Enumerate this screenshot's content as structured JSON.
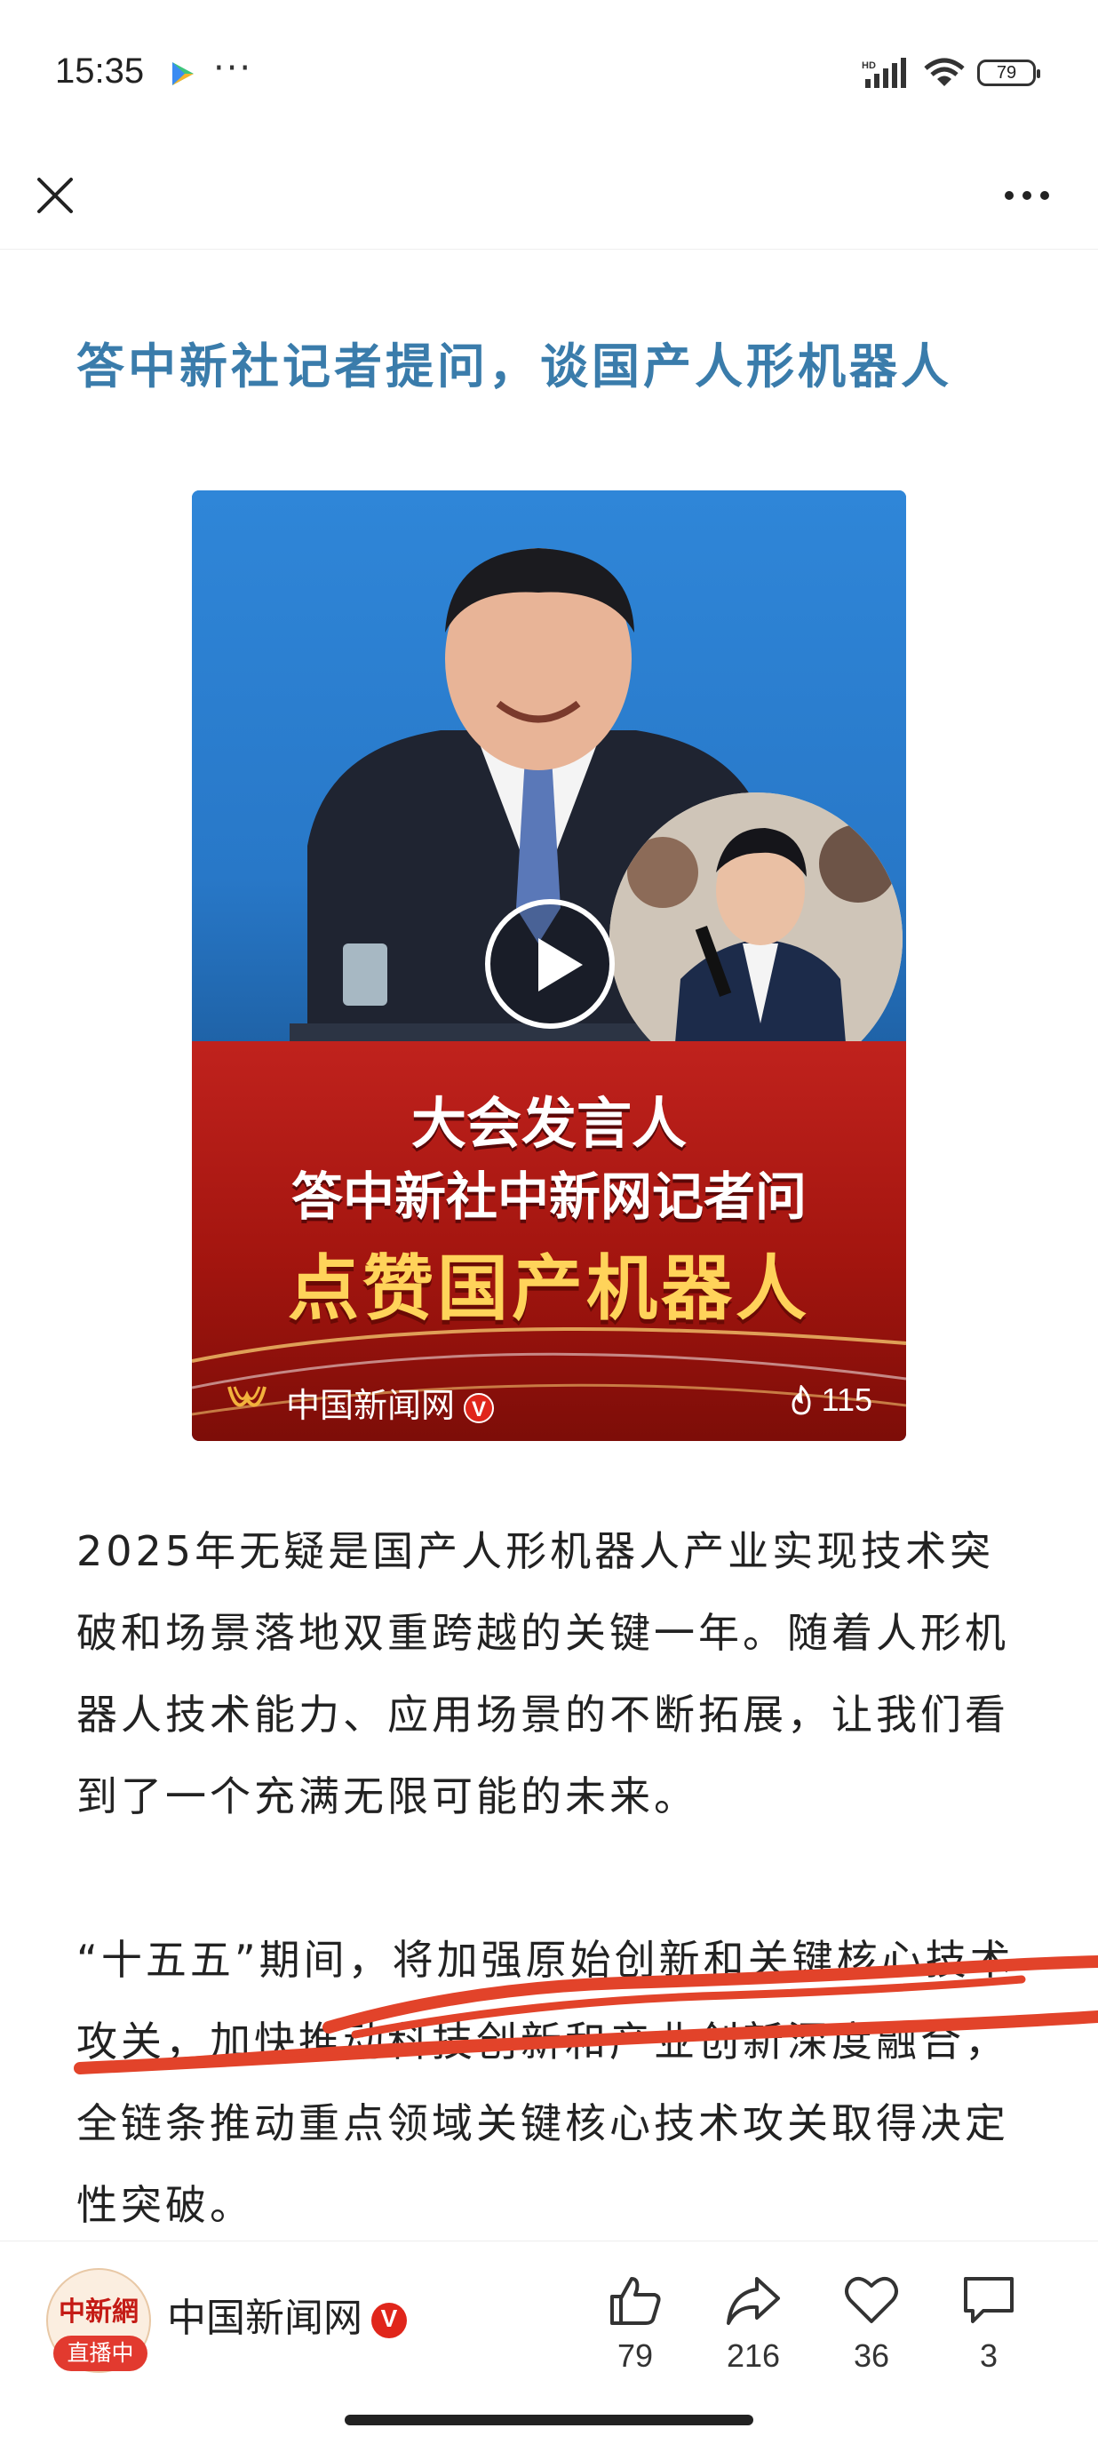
{
  "status_bar": {
    "time": "15:35",
    "more": "···",
    "battery": "79",
    "icons": [
      "app-store-icon",
      "hd-signal-icon",
      "wifi-icon",
      "battery-icon"
    ]
  },
  "nav": {
    "icons": [
      "close-icon",
      "more-icon"
    ]
  },
  "article": {
    "title": "答中新社记者提问，谈国产人形机器人",
    "video": {
      "banner_line1": "大会发言人",
      "banner_line2": "答中新社中新网记者问",
      "banner_line3": "点赞国产机器人",
      "source": "中国新闻网",
      "verified": "V",
      "views": "115",
      "icons": [
        "play-icon",
        "weibo-logo-icon",
        "fire-icon"
      ]
    },
    "paragraphs": [
      "2025年无疑是国产人形机器人产业实现技术突破和场景落地双重跨越的关键一年。随着人形机器人技术能力、应用场景的不断拓展，让我们看到了一个充满无限可能的未来。",
      "“十五五”期间，将加强原始创新和关键核心技术攻关，加快推动科技创新和产业创新深度融合，全链条推动重点领域关键核心技术攻关取得决定性突破。"
    ]
  },
  "bottom_bar": {
    "avatar_logo": "中新網",
    "live_label": "直播中",
    "channel_name": "中国新闻网",
    "verified": "V",
    "actions": {
      "like": "79",
      "share": "216",
      "favorite": "36",
      "comment": "3"
    }
  },
  "colors": {
    "title": "#3a7cab",
    "brand_red": "#e0261b",
    "banner_red": "#c0221d",
    "banner_gold": "#ffd35a",
    "scribble": "#e2432a"
  }
}
